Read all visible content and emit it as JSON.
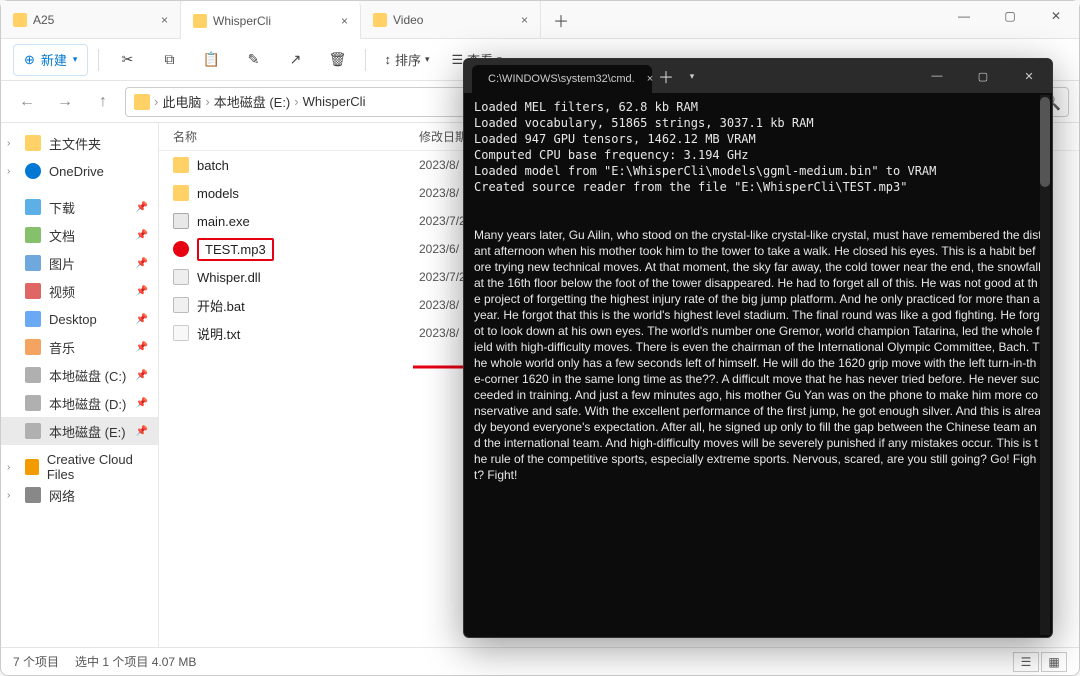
{
  "tabs": [
    {
      "label": "A25",
      "active": false
    },
    {
      "label": "WhisperCli",
      "active": true
    },
    {
      "label": "Video",
      "active": false
    }
  ],
  "toolbar": {
    "new_label": "新建",
    "sort_label": "排序",
    "view_label": "查看"
  },
  "breadcrumb": {
    "parts": [
      "此电脑",
      "本地磁盘 (E:)",
      "WhisperCli"
    ]
  },
  "sidebar": {
    "items": [
      {
        "icon": "home",
        "label": "主文件夹",
        "chev": true
      },
      {
        "icon": "cloud",
        "label": "OneDrive",
        "chev": true,
        "gap": true
      },
      {
        "icon": "dl",
        "label": "下载",
        "pin": true
      },
      {
        "icon": "doc",
        "label": "文档",
        "pin": true
      },
      {
        "icon": "pic",
        "label": "图片",
        "pin": true
      },
      {
        "icon": "vid",
        "label": "视频",
        "pin": true
      },
      {
        "icon": "desk",
        "label": "Desktop",
        "pin": true
      },
      {
        "icon": "music",
        "label": "音乐",
        "pin": true
      },
      {
        "icon": "disk",
        "label": "本地磁盘 (C:)",
        "pin": true
      },
      {
        "icon": "disk",
        "label": "本地磁盘 (D:)",
        "pin": true
      },
      {
        "icon": "disk",
        "label": "本地磁盘 (E:)",
        "pin": true,
        "active": true,
        "gap": true
      },
      {
        "icon": "cc",
        "label": "Creative Cloud Files",
        "chev": true
      },
      {
        "icon": "net",
        "label": "网络",
        "chev": true
      }
    ]
  },
  "columns": {
    "name": "名称",
    "date": "修改日期"
  },
  "files": [
    {
      "icon": "folder",
      "name": "batch",
      "date": "2023/8/"
    },
    {
      "icon": "folder",
      "name": "models",
      "date": "2023/8/"
    },
    {
      "icon": "exe",
      "name": "main.exe",
      "date": "2023/7/2"
    },
    {
      "icon": "mp3",
      "name": "TEST.mp3",
      "date": "2023/6/",
      "highlight": true
    },
    {
      "icon": "dll",
      "name": "Whisper.dll",
      "date": "2023/7/2"
    },
    {
      "icon": "bat",
      "name": "开始.bat",
      "date": "2023/8/"
    },
    {
      "icon": "txt",
      "name": "说明.txt",
      "date": "2023/8/"
    }
  ],
  "status": {
    "count": "7 个项目",
    "selection": "选中 1 个项目 4.07 MB"
  },
  "cmd": {
    "title": "C:\\WINDOWS\\system32\\cmd.",
    "log": [
      "Loaded MEL filters, 62.8 kb RAM",
      "Loaded vocabulary, 51865 strings, 3037.1 kb RAM",
      "Loaded 947 GPU tensors, 1462.12 MB VRAM",
      "Computed CPU base frequency: 3.194 GHz",
      "Loaded model from \"E:\\WhisperCli\\models\\ggml-medium.bin\" to VRAM",
      "Created source reader from the file \"E:\\WhisperCli\\TEST.mp3\""
    ],
    "transcript": "Many years later, Gu Ailin, who stood on the crystal-like crystal-like crystal, must have remembered the distant afternoon when his mother took him to the tower to take a walk. He closed his eyes. This is a habit before trying new technical moves. At that moment, the sky far away, the cold tower near the end, the snowfall at the 16th floor below the foot of the tower disappeared. He had to forget all of this. He was not good at the project of forgetting the highest injury rate of the big jump platform. And he only practiced for more than a year. He forgot that this is the world's highest level stadium. The final round was like a god fighting. He forgot to look down at his own eyes. The world's number one Gremor, world champion Tatarina, led the whole field with high-difficulty moves. There is even the chairman of the International Olympic Committee, Bach. The whole world only has a few seconds left of himself. He will do the 1620 grip move with the left turn-in-the-corner 1620 in the same long time as the??. A difficult move that he has never tried before. He never succeeded in training. And just a few minutes ago, his mother Gu Yan was on the phone to make him more conservative and safe. With the excellent performance of the first jump, he got enough silver. And this is already beyond everyone's expectation. After all, he signed up only to fill the gap between the Chinese team and the international team. And high-difficulty moves will be severely punished if any mistakes occur. This is the rule of the competitive sports, especially extreme sports. Nervous, scared, are you still going? Go! Fight? Fight!"
  }
}
